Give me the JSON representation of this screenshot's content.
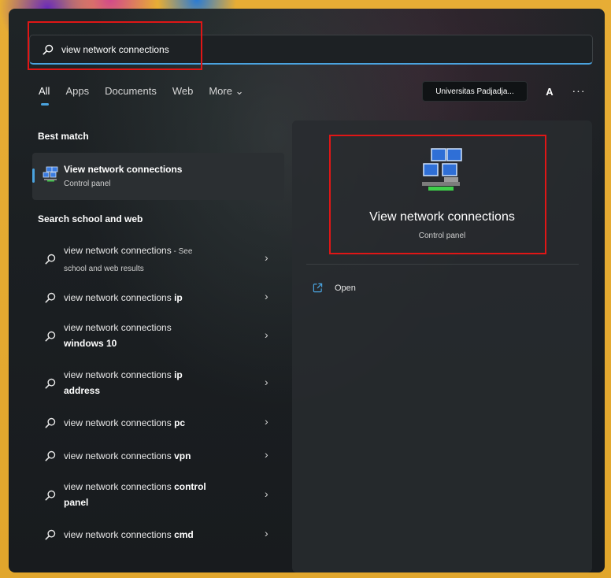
{
  "search": {
    "value": "view network connections",
    "placeholder": ""
  },
  "tabs": [
    {
      "label": "All",
      "active": true
    },
    {
      "label": "Apps"
    },
    {
      "label": "Documents"
    },
    {
      "label": "Web"
    },
    {
      "label": "More ⌄"
    }
  ],
  "account": {
    "org_label": "Universitas Padjadja...",
    "avatar_letter": "A",
    "more_label": "···"
  },
  "best_match": {
    "heading": "Best match",
    "title": "View network connections",
    "subtitle": "Control panel"
  },
  "search_web": {
    "heading": "Search school and web",
    "items": [
      {
        "plain": "view network connections",
        "bold": "",
        "suffix": " - See",
        "line2": "school and web results"
      },
      {
        "plain": "view network connections ",
        "bold": "ip",
        "suffix": "",
        "line2": ""
      },
      {
        "plain": "view network connections",
        "bold": "",
        "suffix": "",
        "line2": "windows 10"
      },
      {
        "plain": "view network connections ",
        "bold": "ip",
        "suffix": "",
        "line2": "address"
      },
      {
        "plain": "view network connections ",
        "bold": "pc",
        "suffix": "",
        "line2": ""
      },
      {
        "plain": "view network connections ",
        "bold": "vpn",
        "suffix": "",
        "line2": ""
      },
      {
        "plain": "view network connections ",
        "bold": "control",
        "suffix": "",
        "line2": "panel"
      },
      {
        "plain": "view network connections ",
        "bold": "cmd",
        "suffix": "",
        "line2": ""
      }
    ],
    "chevron": "›"
  },
  "preview": {
    "title": "View network connections",
    "subtitle": "Control panel",
    "action_open": "Open"
  },
  "colors": {
    "accent": "#4aa3df",
    "highlight_box": "#e01616",
    "frame": "#e3a92f"
  },
  "icons": {
    "search": "search-icon",
    "network": "network-connections-icon",
    "open": "open-external-icon",
    "chevron": "chevron-right-icon"
  }
}
